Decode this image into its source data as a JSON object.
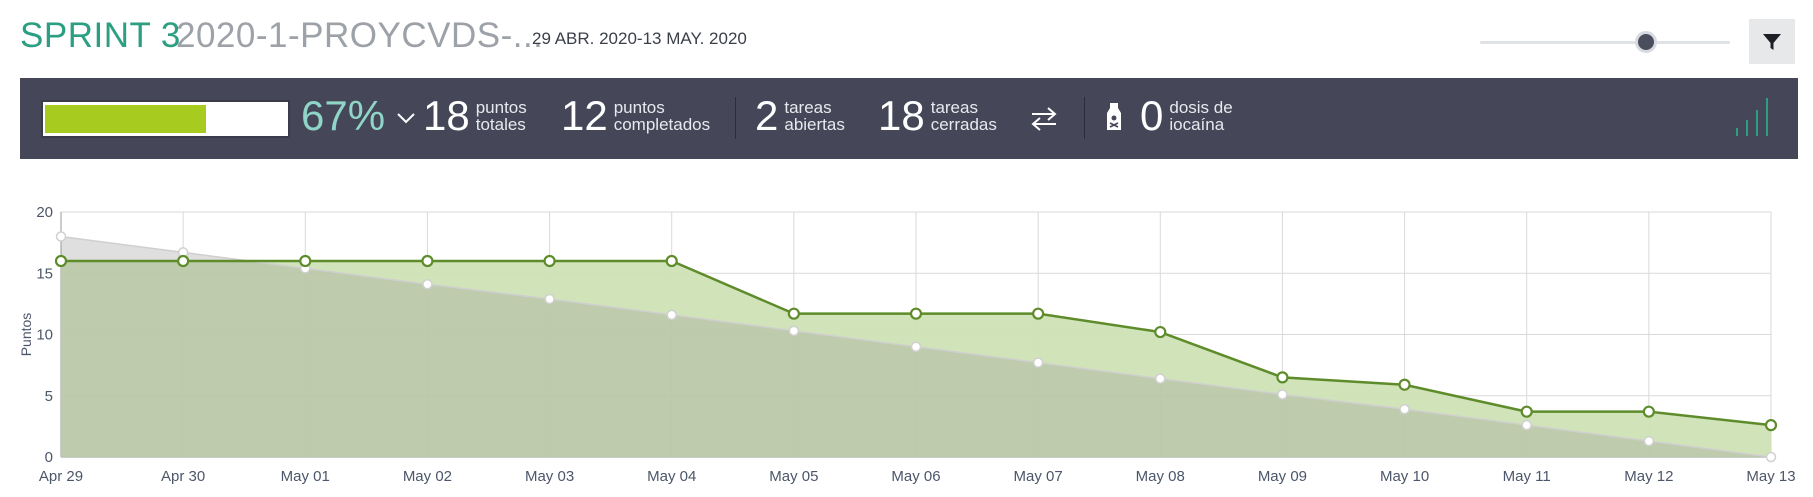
{
  "header": {
    "sprint_name": "SPRINT 3",
    "project_name": "2020-1-PROYCVDS-...",
    "dates": "29 ABR. 2020-13 MAY. 2020"
  },
  "stats": {
    "progress_percent": 67,
    "progress_text": "67%",
    "total_points": {
      "value": "18",
      "label_line1": "puntos",
      "label_line2": "totales"
    },
    "completed_points": {
      "value": "12",
      "label_line1": "puntos",
      "label_line2": "completados"
    },
    "open_tasks": {
      "value": "2",
      "label_line1": "tareas",
      "label_line2": "abiertas"
    },
    "closed_tasks": {
      "value": "18",
      "label_line1": "tareas",
      "label_line2": "cerradas"
    },
    "iocaine": {
      "value": "0",
      "label_line1": "dosis de",
      "label_line2": "iocaína"
    }
  },
  "colors": {
    "accent": "#2c9f83",
    "progress": "#a7cb1f",
    "bar_background": "#454758",
    "actual_line": "#5e8c2b",
    "actual_fill": "#cfe1b5",
    "ideal_fill": "#dcdcdc"
  },
  "icons": {
    "chevron": "chevron-down-icon",
    "swap": "swap-arrows-icon",
    "bottle": "poison-bottle-icon",
    "graph": "bar-graph-icon",
    "filter": "filter-funnel-icon"
  },
  "chart_data": {
    "type": "area",
    "xlabel": "",
    "ylabel": "Puntos",
    "ylim": [
      0,
      20
    ],
    "yticks": [
      0,
      5,
      10,
      15,
      20
    ],
    "grid": true,
    "categories": [
      "Apr 29",
      "Apr 30",
      "May 01",
      "May 02",
      "May 03",
      "May 04",
      "May 05",
      "May 06",
      "May 07",
      "May 08",
      "May 09",
      "May 10",
      "May 11",
      "May 12",
      "May 13"
    ],
    "series": [
      {
        "values": [
          18,
          16.7,
          15.4,
          14.1,
          12.9,
          11.6,
          10.3,
          9.0,
          7.7,
          6.4,
          5.1,
          3.9,
          2.6,
          1.3,
          0
        ]
      },
      {
        "values": [
          16,
          16,
          16,
          16,
          16,
          16,
          11.7,
          11.7,
          11.7,
          10.2,
          6.5,
          5.9,
          3.7,
          3.7,
          2.6
        ]
      }
    ]
  }
}
